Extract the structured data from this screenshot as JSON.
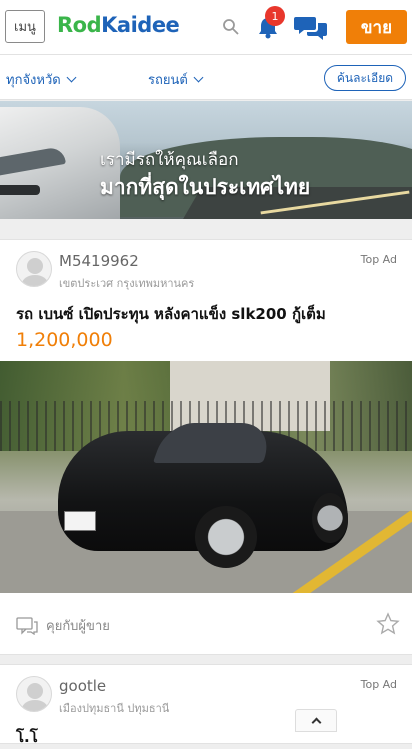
{
  "header": {
    "menu_label": "เมนู",
    "logo_part1": "Rod",
    "logo_part2": "Kaidee",
    "notification_count": "1",
    "sell_label": "ขาย"
  },
  "filters": {
    "province": "ทุกจังหวัด",
    "category": "รถยนต์",
    "advanced_search": "ค้นละเอียด"
  },
  "banner": {
    "line1": "เรามีรถให้คุณเลือก",
    "line2": "มากที่สุดในประเทศไทย"
  },
  "listings": [
    {
      "seller": "M5419962",
      "location": "เขตประเวศ กรุงเทพมหานคร",
      "badge": "Top Ad",
      "title": "รถ เบนซ์ เปิดประทุน หลังคาแข็ง slk200 กู้เต็ม",
      "price": "1,200,000",
      "chat_label": "คุยกับผู้ขาย"
    },
    {
      "seller": "gootle",
      "location": "เมืองปทุมธานี ปทุมธานี",
      "badge": "Top Ad",
      "title": "โ.โ"
    }
  ],
  "colors": {
    "brand_green": "#3ab54a",
    "brand_blue": "#1e63b8",
    "accent_orange": "#f07f08",
    "badge_red": "#e8372c"
  }
}
